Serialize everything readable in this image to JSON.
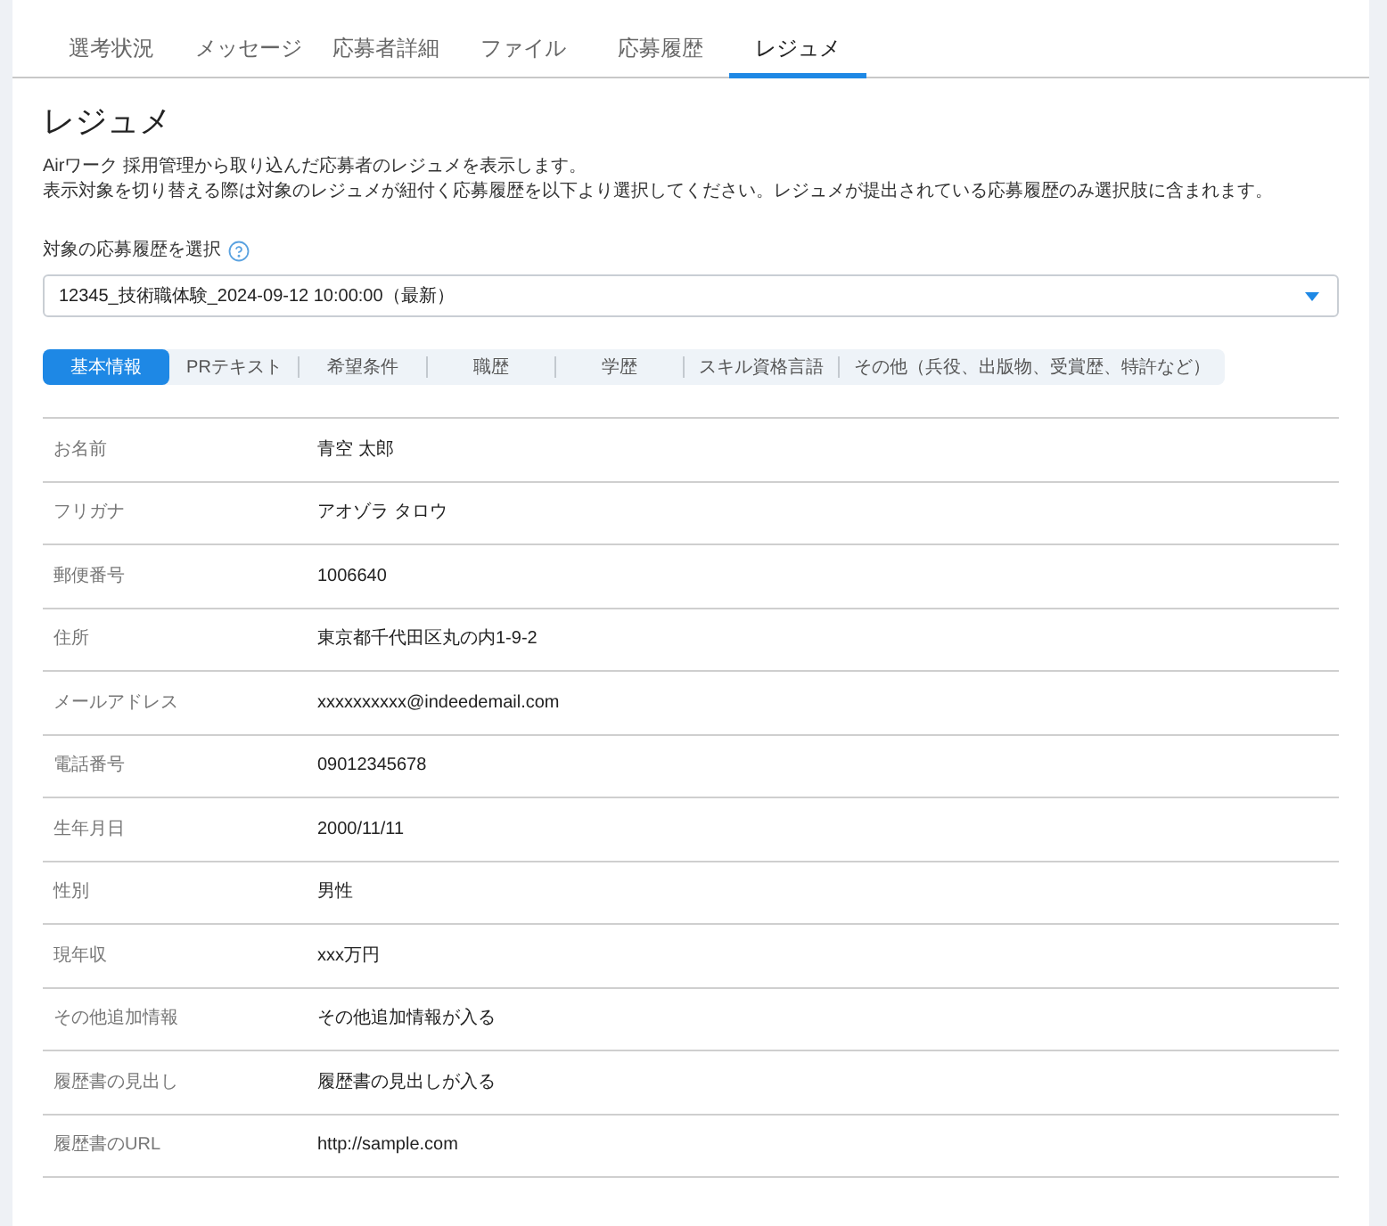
{
  "tabs": [
    {
      "label": "選考状況",
      "selected": false
    },
    {
      "label": "メッセージ",
      "selected": false
    },
    {
      "label": "応募者詳細",
      "selected": false
    },
    {
      "label": "ファイル",
      "selected": false
    },
    {
      "label": "応募履歴",
      "selected": false
    },
    {
      "label": "レジュメ",
      "selected": true
    }
  ],
  "page": {
    "title": "レジュメ",
    "description": [
      "Airワーク 採用管理から取り込んだ応募者のレジュメを表示します。",
      "表示対象を切り替える際は対象のレジュメが紐付く応募履歴を以下より選択してください。レジュメが提出されている応募履歴のみ選択肢に含まれます。"
    ]
  },
  "history_select": {
    "label": "対象の応募履歴を選択",
    "value": "12345_技術職体験_2024-09-12 10:00:00（最新）"
  },
  "section_tabs": [
    {
      "label": "基本情報",
      "selected": true
    },
    {
      "label": "PRテキスト",
      "selected": false
    },
    {
      "label": "希望条件",
      "selected": false
    },
    {
      "label": "職歴",
      "selected": false
    },
    {
      "label": "学歴",
      "selected": false
    },
    {
      "label": "スキル資格言語",
      "selected": false
    },
    {
      "label": "その他（兵役、出版物、受賞歴、特許など）",
      "selected": false
    }
  ],
  "fields": [
    {
      "label": "お名前",
      "value": "青空 太郎"
    },
    {
      "label": "フリガナ",
      "value": "アオゾラ タロウ"
    },
    {
      "label": "郵便番号",
      "value": "1006640"
    },
    {
      "label": "住所",
      "value": "東京都千代田区丸の内1-9-2"
    },
    {
      "label": "メールアドレス",
      "value": "xxxxxxxxxx@indeedemail.com"
    },
    {
      "label": "電話番号",
      "value": "09012345678"
    },
    {
      "label": "生年月日",
      "value": "2000/11/11"
    },
    {
      "label": "性別",
      "value": "男性"
    },
    {
      "label": "現年収",
      "value": "xxx万円"
    },
    {
      "label": "その他追加情報",
      "value": "その他追加情報が入る"
    },
    {
      "label": "履歴書の見出し",
      "value": "履歴書の見出しが入る"
    },
    {
      "label": "履歴書のURL",
      "value": "http://sample.com"
    }
  ]
}
